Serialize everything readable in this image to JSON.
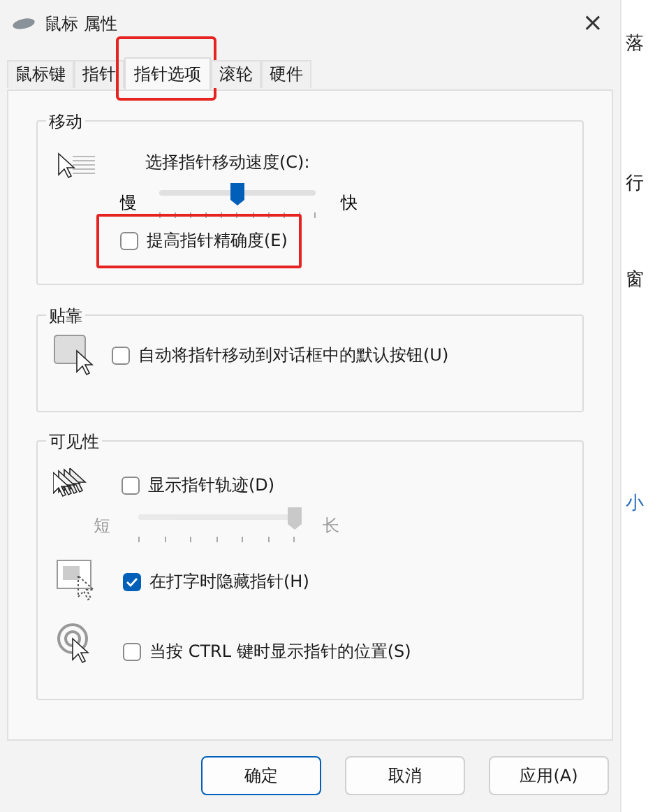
{
  "window": {
    "title": "鼠标 属性",
    "close": "×"
  },
  "tabs": [
    {
      "label": "鼠标键",
      "selected": false,
      "highlighted": false
    },
    {
      "label": "指针",
      "selected": false,
      "highlighted": false
    },
    {
      "label": "指针选项",
      "selected": true,
      "highlighted": true
    },
    {
      "label": "滚轮",
      "selected": false,
      "highlighted": false
    },
    {
      "label": "硬件",
      "selected": false,
      "highlighted": false
    }
  ],
  "motion": {
    "title": "移动",
    "speed_label": "选择指针移动速度(C):",
    "slow": "慢",
    "fast": "快",
    "speed": {
      "level": 0.5,
      "disabled": false
    },
    "precision": {
      "label": "提高指针精确度(E)",
      "checked": false,
      "highlighted": true
    }
  },
  "snap": {
    "title": "贴靠",
    "option": {
      "label": "自动将指针移动到对话框中的默认按钮(U)",
      "checked": false
    }
  },
  "visibility": {
    "title": "可见性",
    "trails": {
      "label": "显示指针轨迹(D)",
      "checked": false
    },
    "short": "短",
    "long": "长",
    "trail_length": {
      "level": 1,
      "disabled": true
    },
    "hide": {
      "label": "在打字时隐藏指针(H)",
      "checked": true
    },
    "ctrl": {
      "label": "当按 CTRL 键时显示指针的位置(S)",
      "checked": false
    }
  },
  "buttons": [
    {
      "label": "确定",
      "default": true
    },
    {
      "label": "取消",
      "default": false
    },
    {
      "label": "应用(A)",
      "default": false
    }
  ],
  "background_fragments": [
    "落",
    "行",
    "窗",
    "小"
  ]
}
